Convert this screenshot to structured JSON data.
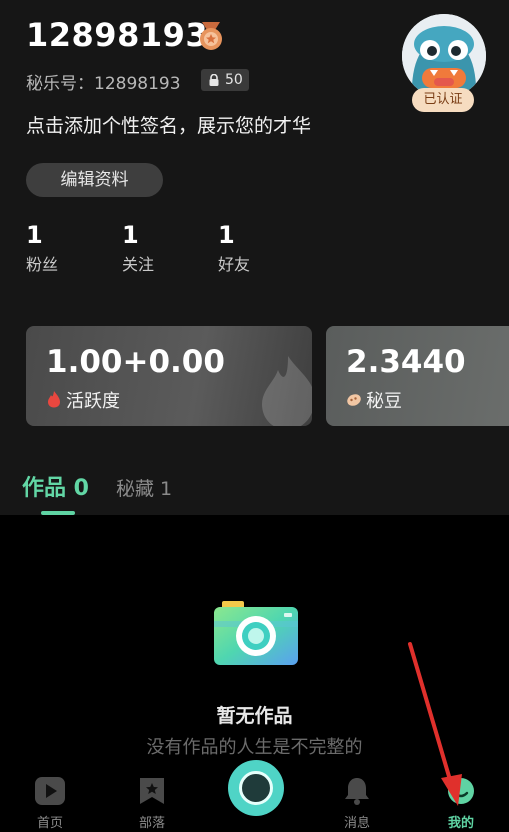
{
  "profile": {
    "username": "12898193",
    "id_label": "秘乐号：",
    "id_value": "12898193",
    "lock_count": "50",
    "verified_label": "已认证",
    "bio": "点击添加个性签名，展示您的才华",
    "edit_button": "编辑资料"
  },
  "stats": [
    {
      "value": "1",
      "label": "粉丝"
    },
    {
      "value": "1",
      "label": "关注"
    },
    {
      "value": "1",
      "label": "好友"
    }
  ],
  "cards": {
    "activity": {
      "value": "1.00+0.00",
      "label": "活跃度"
    },
    "beans": {
      "value": "2.3440",
      "label": "秘豆"
    }
  },
  "tabs": {
    "works": "作品 0",
    "secret": "秘藏 1"
  },
  "empty_state": {
    "title": "暂无作品",
    "subtitle": "没有作品的人生是不完整的"
  },
  "nav": {
    "home": "首页",
    "tribe": "部落",
    "messages": "消息",
    "mine": "我的"
  },
  "colors": {
    "accent": "#5fd3a3",
    "background_top": "#161616",
    "background_bottom": "#000000",
    "annotation_arrow": "#e0302c"
  },
  "icons": {
    "medal": "medal-icon",
    "lock": "lock-icon",
    "flame": "flame-icon",
    "bean": "bean-icon",
    "camera": "camera-icon",
    "home": "play-icon",
    "tribe": "bookmark-star-icon",
    "messages": "bell-icon",
    "mine": "face-icon"
  }
}
